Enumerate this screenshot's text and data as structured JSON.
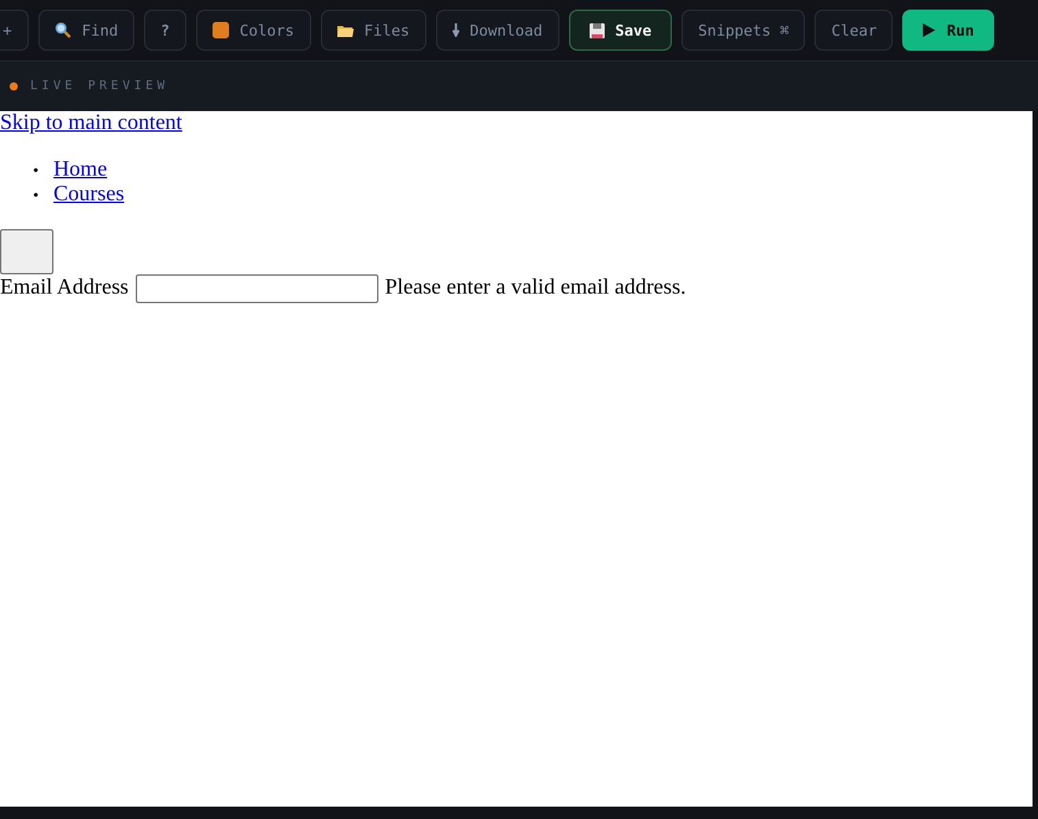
{
  "toolbar": {
    "buttons": [
      {
        "label": "+",
        "kind": "plain"
      },
      {
        "label": "Find",
        "kind": "plain"
      },
      {
        "label": "?",
        "kind": "plain"
      },
      {
        "label": "Colors",
        "kind": "plain"
      },
      {
        "label": "Files",
        "kind": "plain"
      },
      {
        "label": "Download",
        "kind": "plain"
      },
      {
        "label": "Save",
        "kind": "save"
      },
      {
        "label": "Snippets ⌘",
        "kind": "plain"
      },
      {
        "label": "Clear",
        "kind": "plain"
      },
      {
        "label": "Run",
        "kind": "run"
      }
    ]
  },
  "preview_header": {
    "title": "LIVE PREVIEW"
  },
  "preview": {
    "skip_link": "Skip to main content",
    "nav": [
      {
        "marker": "•",
        "label": "Home"
      },
      {
        "marker": "•",
        "label": "Courses"
      }
    ],
    "email_label": "Email Address",
    "error": "Please enter a valid email address."
  }
}
